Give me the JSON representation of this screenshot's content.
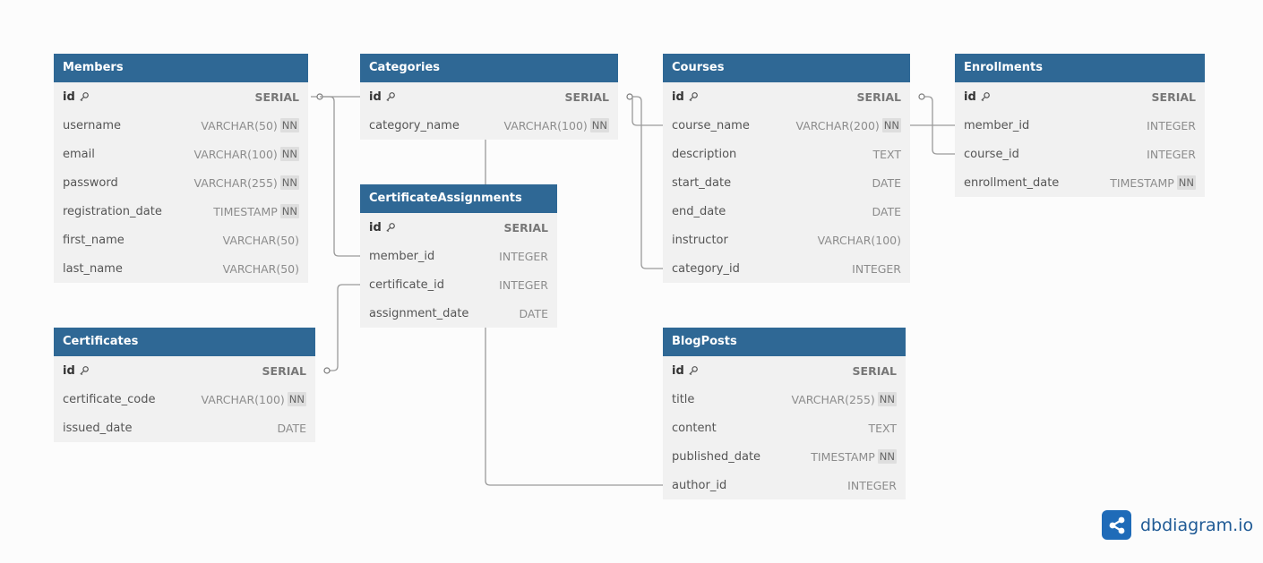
{
  "tables": [
    {
      "name": "Members",
      "columns": [
        {
          "name": "id",
          "type": "SERIAL",
          "pk": true
        },
        {
          "name": "username",
          "type": "VARCHAR(50)",
          "nn": "NN"
        },
        {
          "name": "email",
          "type": "VARCHAR(100)",
          "nn": "NN"
        },
        {
          "name": "password",
          "type": "VARCHAR(255)",
          "nn": "NN"
        },
        {
          "name": "registration_date",
          "type": "TIMESTAMP",
          "nn": "NN"
        },
        {
          "name": "first_name",
          "type": "VARCHAR(50)"
        },
        {
          "name": "last_name",
          "type": "VARCHAR(50)"
        }
      ]
    },
    {
      "name": "Categories",
      "columns": [
        {
          "name": "id",
          "type": "SERIAL",
          "pk": true
        },
        {
          "name": "category_name",
          "type": "VARCHAR(100)",
          "nn": "NN"
        }
      ]
    },
    {
      "name": "Courses",
      "columns": [
        {
          "name": "id",
          "type": "SERIAL",
          "pk": true
        },
        {
          "name": "course_name",
          "type": "VARCHAR(200)",
          "nn": "NN"
        },
        {
          "name": "description",
          "type": "TEXT"
        },
        {
          "name": "start_date",
          "type": "DATE"
        },
        {
          "name": "end_date",
          "type": "DATE"
        },
        {
          "name": "instructor",
          "type": "VARCHAR(100)"
        },
        {
          "name": "category_id",
          "type": "INTEGER"
        }
      ]
    },
    {
      "name": "Enrollments",
      "columns": [
        {
          "name": "id",
          "type": "SERIAL",
          "pk": true
        },
        {
          "name": "member_id",
          "type": "INTEGER"
        },
        {
          "name": "course_id",
          "type": "INTEGER"
        },
        {
          "name": "enrollment_date",
          "type": "TIMESTAMP",
          "nn": "NN"
        }
      ]
    },
    {
      "name": "CertificateAssignments",
      "columns": [
        {
          "name": "id",
          "type": "SERIAL",
          "pk": true
        },
        {
          "name": "member_id",
          "type": "INTEGER"
        },
        {
          "name": "certificate_id",
          "type": "INTEGER"
        },
        {
          "name": "assignment_date",
          "type": "DATE"
        }
      ]
    },
    {
      "name": "Certificates",
      "columns": [
        {
          "name": "id",
          "type": "SERIAL",
          "pk": true
        },
        {
          "name": "certificate_code",
          "type": "VARCHAR(100)",
          "nn": "NN"
        },
        {
          "name": "issued_date",
          "type": "DATE"
        }
      ]
    },
    {
      "name": "BlogPosts",
      "columns": [
        {
          "name": "id",
          "type": "SERIAL",
          "pk": true
        },
        {
          "name": "title",
          "type": "VARCHAR(255)",
          "nn": "NN"
        },
        {
          "name": "content",
          "type": "TEXT"
        },
        {
          "name": "published_date",
          "type": "TIMESTAMP",
          "nn": "NN"
        },
        {
          "name": "author_id",
          "type": "INTEGER"
        }
      ]
    }
  ],
  "relations": [
    {
      "from": "Members.id",
      "to": "CertificateAssignments.member_id",
      "cardinality": "one-to-many"
    },
    {
      "from": "Categories.id",
      "to": "Courses.category_id",
      "cardinality": "one-to-many"
    },
    {
      "from": "Courses.id",
      "to": "Enrollments.course_id",
      "cardinality": "one-to-many"
    },
    {
      "from": "Members.id",
      "to": "Enrollments.member_id",
      "cardinality": "one-to-many"
    },
    {
      "from": "Certificates.id",
      "to": "CertificateAssignments.certificate_id",
      "cardinality": "one-to-many"
    },
    {
      "from": "Members.id",
      "to": "BlogPosts.author_id",
      "cardinality": "one-to-many"
    }
  ],
  "brand": {
    "logo_text": "dbdiagram.io",
    "color": "#1f6bb8"
  },
  "colors": {
    "header": "#2f6895",
    "body": "#f1f1f1",
    "line": "#9a9a9a",
    "background": "#fcfcfc"
  },
  "icons": {
    "key": "key-icon",
    "logo": "share-nodes-icon"
  }
}
